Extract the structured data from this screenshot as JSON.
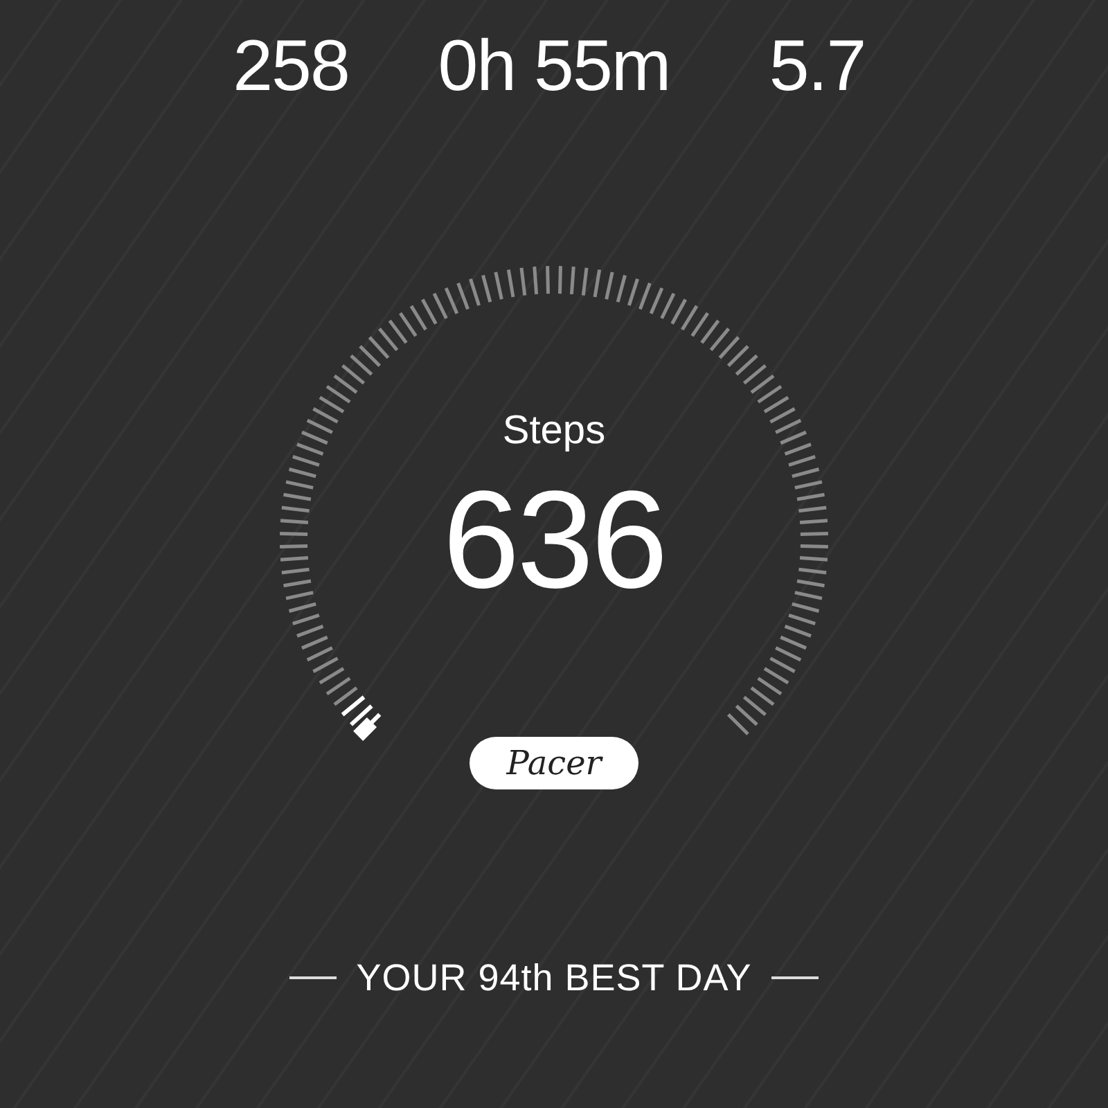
{
  "stats": [
    {
      "value": "258"
    },
    {
      "value": "0h 55m"
    },
    {
      "value": "5.7"
    }
  ],
  "steps_gauge": {
    "label": "Steps",
    "value": "636"
  },
  "brand_badge": "Pacer",
  "best_day": "YOUR 94th BEST DAY"
}
